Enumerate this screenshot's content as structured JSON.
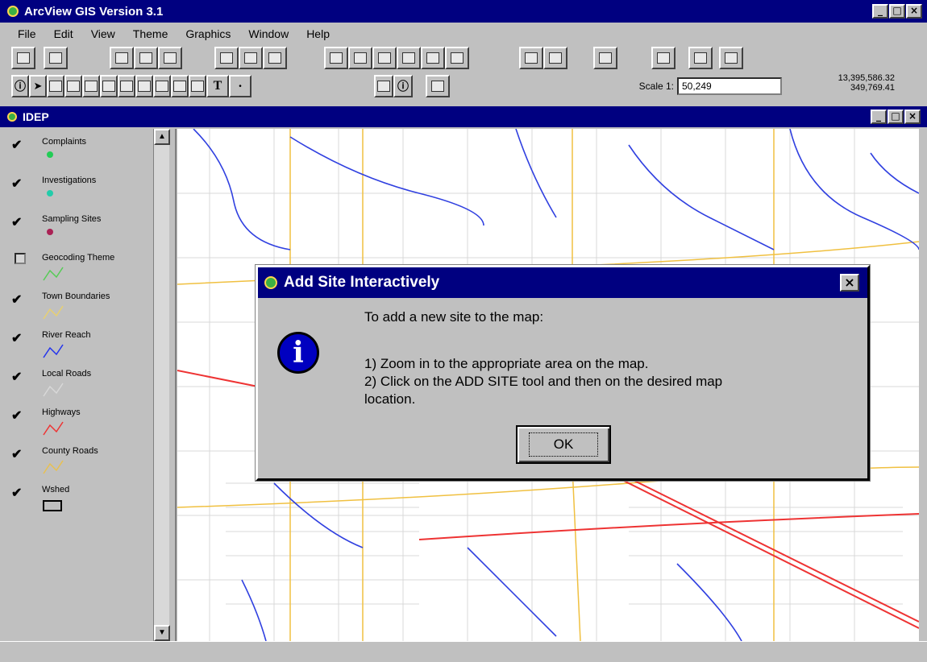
{
  "app": {
    "title": "ArcView GIS Version 3.1"
  },
  "menu": [
    "File",
    "Edit",
    "View",
    "Theme",
    "Graphics",
    "Window",
    "Help"
  ],
  "scale": {
    "label": "Scale 1:",
    "value": "50,249"
  },
  "coords": {
    "x": "13,395,586.32",
    "y": "349,769.41"
  },
  "view": {
    "title": "IDEP"
  },
  "toc": [
    {
      "label": "Complaints",
      "checked": true,
      "symbol": "point",
      "color": "#22cc55"
    },
    {
      "label": "Investigations",
      "checked": true,
      "symbol": "point",
      "color": "#22ccaa"
    },
    {
      "label": "Sampling Sites",
      "checked": true,
      "symbol": "point",
      "color": "#aa2255"
    },
    {
      "label": "Geocoding Theme",
      "checked": false,
      "symbol": "line",
      "color": "#55cc55"
    },
    {
      "label": "Town Boundaries",
      "checked": true,
      "symbol": "line",
      "color": "#e8d070"
    },
    {
      "label": "River Reach",
      "checked": true,
      "symbol": "line",
      "color": "#2233ee"
    },
    {
      "label": "Local Roads",
      "checked": true,
      "symbol": "line",
      "color": "#d8d8d8"
    },
    {
      "label": "Highways",
      "checked": true,
      "symbol": "line",
      "color": "#ee3333"
    },
    {
      "label": "County Roads",
      "checked": true,
      "symbol": "line",
      "color": "#e8c050"
    },
    {
      "label": "Wshed",
      "checked": true,
      "symbol": "polygon",
      "color": "#000000"
    }
  ],
  "dialog": {
    "title": "Add Site Interactively",
    "intro": "To add a new site to the map:",
    "step1": "1) Zoom in to the appropriate area on the map.",
    "step2": "2) Click on the ADD SITE tool and then on the desired map",
    "step2b": "location.",
    "ok_label": "OK"
  }
}
